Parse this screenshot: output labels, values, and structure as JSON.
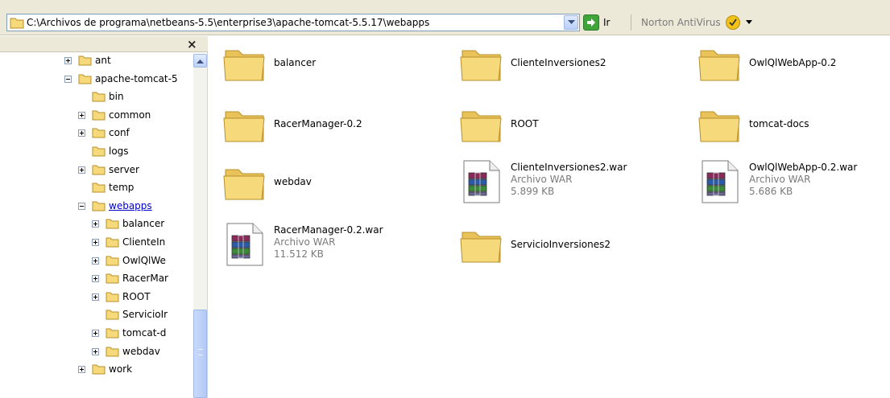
{
  "address_bar": {
    "path": "C:\\Archivos de programa\\netbeans-5.5\\enterprise3\\apache-tomcat-5.5.17\\webapps",
    "go_label": "Ir",
    "norton_label": "Norton AntiVirus"
  },
  "tree": {
    "close_glyph": "×",
    "nodes": [
      {
        "label": "ant",
        "expander": "+"
      },
      {
        "label": "apache-tomcat-5",
        "expander": "-"
      },
      {
        "label": "bin",
        "expander": ""
      },
      {
        "label": "common",
        "expander": "+"
      },
      {
        "label": "conf",
        "expander": "+"
      },
      {
        "label": "logs",
        "expander": ""
      },
      {
        "label": "server",
        "expander": "+"
      },
      {
        "label": "temp",
        "expander": ""
      },
      {
        "label": "webapps",
        "expander": "-",
        "selected": true
      },
      {
        "label": "balancer",
        "expander": "+"
      },
      {
        "label": "ClienteIn",
        "expander": "+"
      },
      {
        "label": "OwlQlWe",
        "expander": "+"
      },
      {
        "label": "RacerMar",
        "expander": "+"
      },
      {
        "label": "ROOT",
        "expander": "+"
      },
      {
        "label": "ServicioIr",
        "expander": ""
      },
      {
        "label": "tomcat-d",
        "expander": "+"
      },
      {
        "label": "webdav",
        "expander": "+"
      },
      {
        "label": "work",
        "expander": "+"
      }
    ]
  },
  "files": [
    {
      "name": "balancer",
      "type": "folder"
    },
    {
      "name": "ClienteInversiones2",
      "type": "folder"
    },
    {
      "name": "OwlQlWebApp-0.2",
      "type": "folder"
    },
    {
      "name": "RacerManager-0.2",
      "type": "folder"
    },
    {
      "name": "ROOT",
      "type": "folder"
    },
    {
      "name": "tomcat-docs",
      "type": "folder"
    },
    {
      "name": "webdav",
      "type": "folder"
    },
    {
      "name": "ClienteInversiones2.war",
      "type": "war",
      "kind": "Archivo WAR",
      "size": "5.899 KB"
    },
    {
      "name": "OwlQlWebApp-0.2.war",
      "type": "war",
      "kind": "Archivo WAR",
      "size": "5.686 KB"
    },
    {
      "name": "RacerManager-0.2.war",
      "type": "war",
      "kind": "Archivo WAR",
      "size": "11.512 KB"
    },
    {
      "name": "ServicioInversiones2",
      "type": "folder"
    }
  ],
  "colors": {
    "folder": "#f6d97a",
    "selection_text": "#0000cc",
    "toolbar_bg": "#ece9d8"
  }
}
